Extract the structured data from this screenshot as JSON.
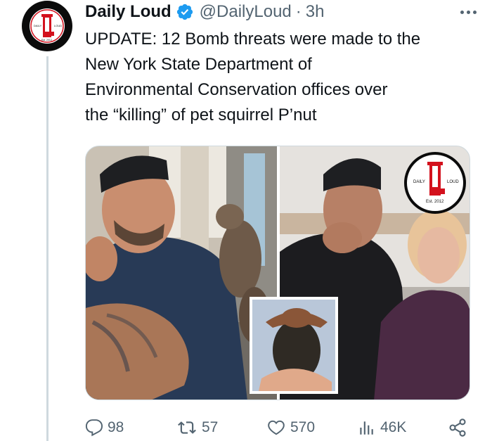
{
  "account": {
    "name": "Daily Loud",
    "handle": "@DailyLoud",
    "separator": "·",
    "time": "3h",
    "logo_text": {
      "brand_left": "DAILY",
      "brand_right": "LOUD",
      "monogram": "DL",
      "est": "Est. 2012"
    }
  },
  "tweet": {
    "lines": [
      "UPDATE: 12 Bomb threats were made to the",
      "New York State Department of",
      "Environmental Conservation offices over",
      "the “killing” of pet squirrel P’nut"
    ]
  },
  "media": {
    "watermark": {
      "brand_left": "DAILY",
      "brand_right": "LOUD",
      "est": "Est. 2012"
    }
  },
  "actions": {
    "replies": "98",
    "reposts": "57",
    "likes": "570",
    "views": "46K"
  },
  "colors": {
    "text": "#0f1419",
    "secondary": "#536471",
    "verified": "#1d9bf0",
    "logo_red": "#d3111d"
  }
}
